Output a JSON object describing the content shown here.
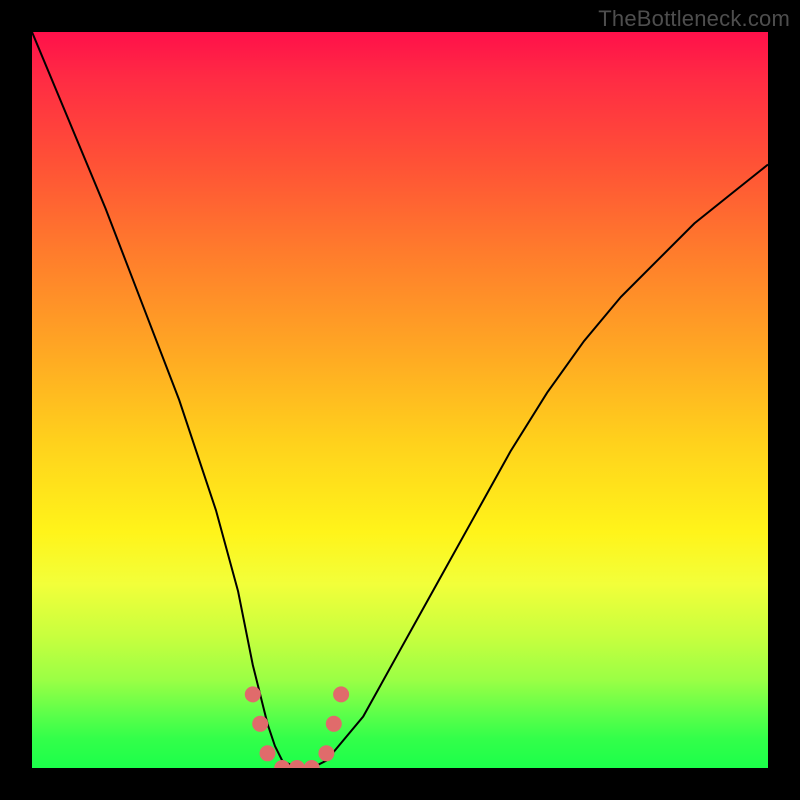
{
  "watermark": "TheBottleneck.com",
  "chart_data": {
    "type": "line",
    "title": "",
    "xlabel": "",
    "ylabel": "",
    "xlim": [
      0,
      100
    ],
    "ylim": [
      0,
      100
    ],
    "grid": false,
    "legend": false,
    "series": [
      {
        "name": "curve",
        "x": [
          0,
          5,
          10,
          15,
          20,
          25,
          28,
          30,
          32,
          33,
          34,
          36,
          38,
          40,
          45,
          50,
          55,
          60,
          65,
          70,
          75,
          80,
          85,
          90,
          95,
          100
        ],
        "y": [
          100,
          88,
          76,
          63,
          50,
          35,
          24,
          14,
          6,
          3,
          1,
          0,
          0,
          1,
          7,
          16,
          25,
          34,
          43,
          51,
          58,
          64,
          69,
          74,
          78,
          82
        ]
      }
    ],
    "markers": {
      "note": "approximate x positions of highlighted dots near curve minimum, y≈0–10",
      "x": [
        30,
        31,
        32,
        34,
        36,
        38,
        40,
        41,
        42
      ],
      "y": [
        10,
        6,
        2,
        0,
        0,
        0,
        2,
        6,
        10
      ]
    },
    "gradient": {
      "direction": "vertical",
      "stops": [
        {
          "pos": 0.0,
          "color": "#ff104a"
        },
        {
          "pos": 0.3,
          "color": "#ff7c2c"
        },
        {
          "pos": 0.6,
          "color": "#ffe81c"
        },
        {
          "pos": 0.85,
          "color": "#b0ff40"
        },
        {
          "pos": 1.0,
          "color": "#1bff4a"
        }
      ]
    }
  }
}
